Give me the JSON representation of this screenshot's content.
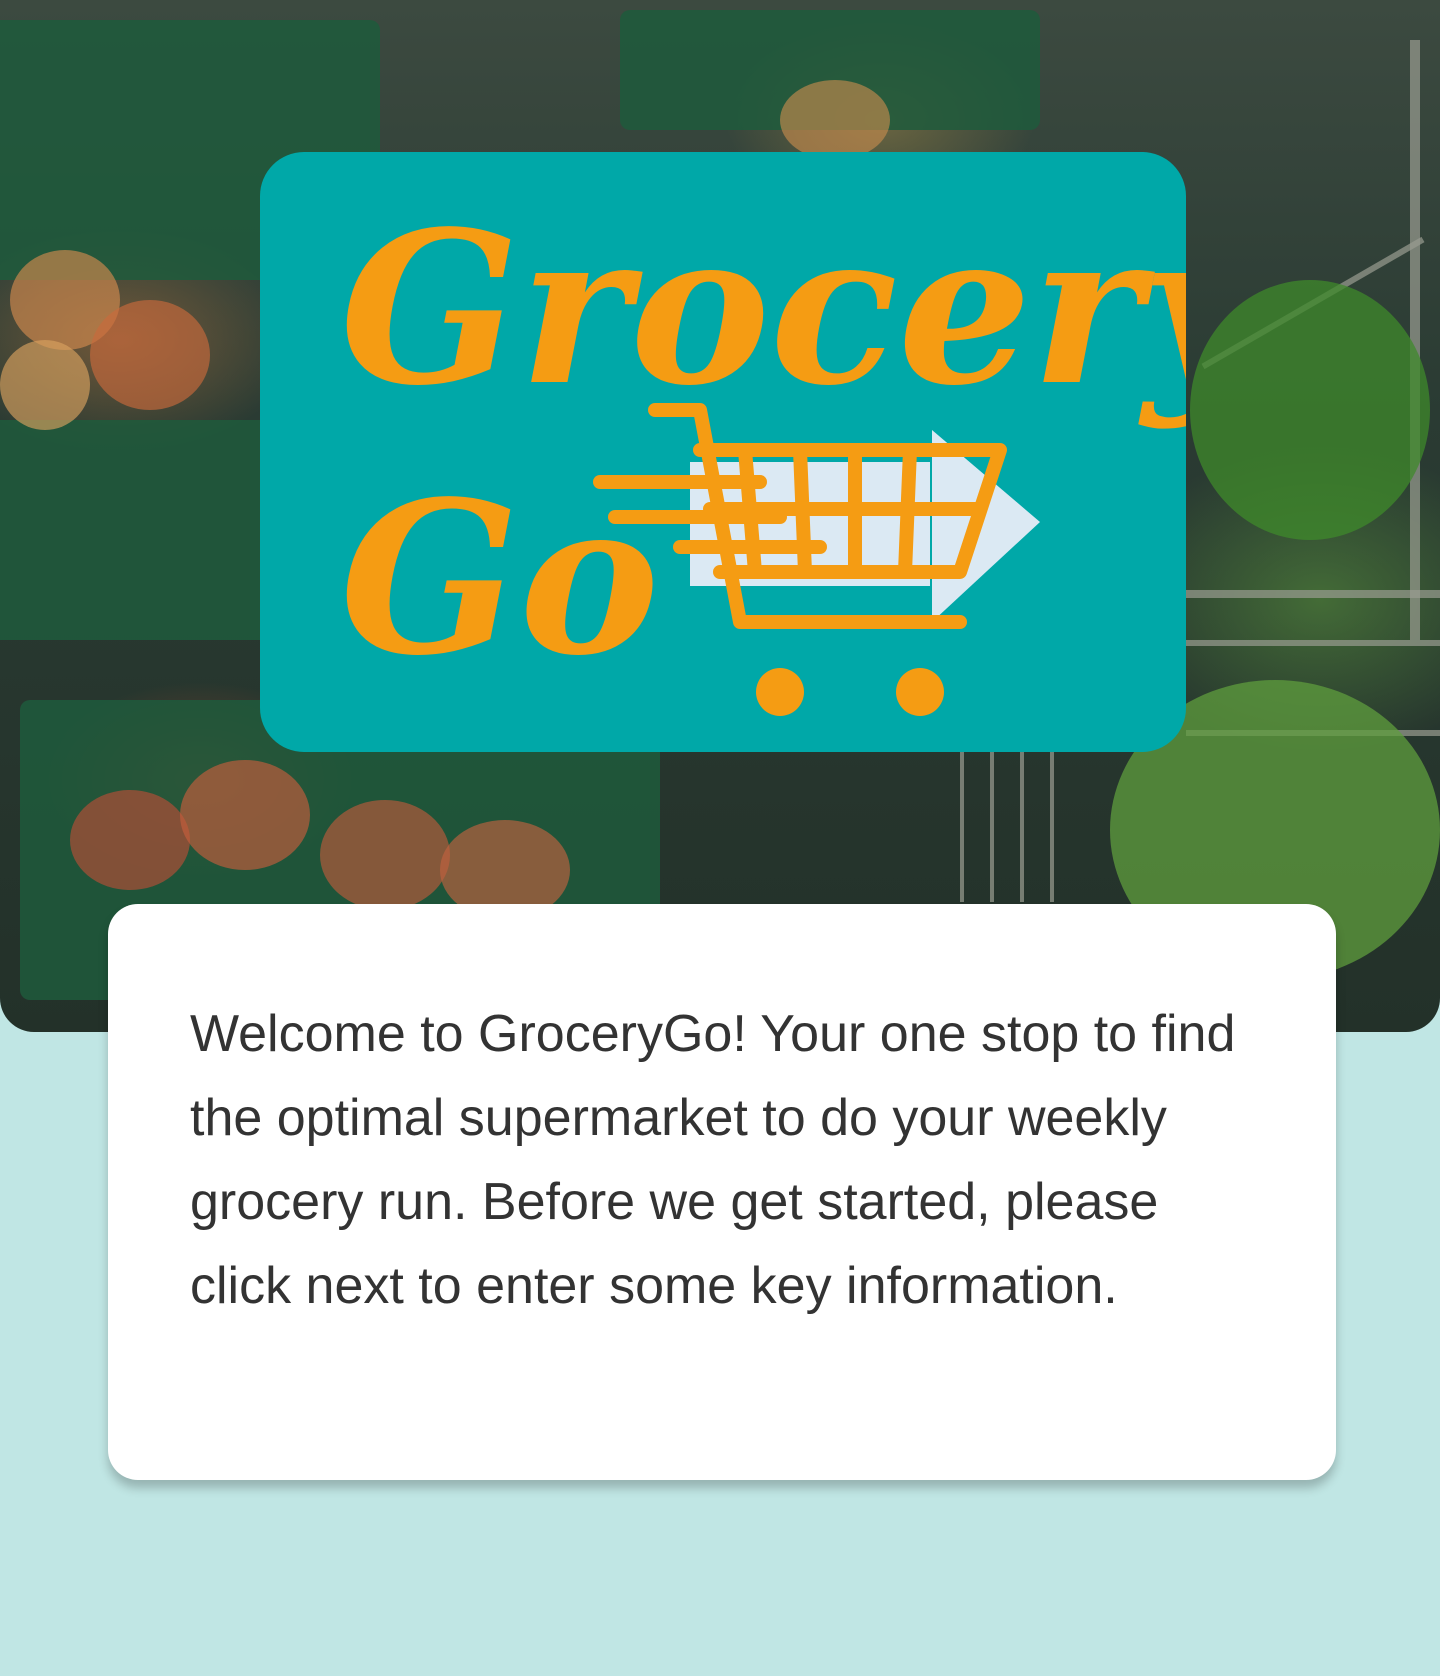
{
  "logo": {
    "line1": "Grocery",
    "line2": "Go",
    "icon": "shopping-cart-icon"
  },
  "welcome": {
    "text": "Welcome to GroceryGo! Your one stop to find the optimal supermarket to do your weekly grocery run. Before we get started, please click next to enter some key information."
  },
  "colors": {
    "logo_background": "#00a8a8",
    "logo_foreground": "#f59c13",
    "page_background": "#c0e6e4",
    "card_background": "#ffffff",
    "body_text": "#333333"
  }
}
